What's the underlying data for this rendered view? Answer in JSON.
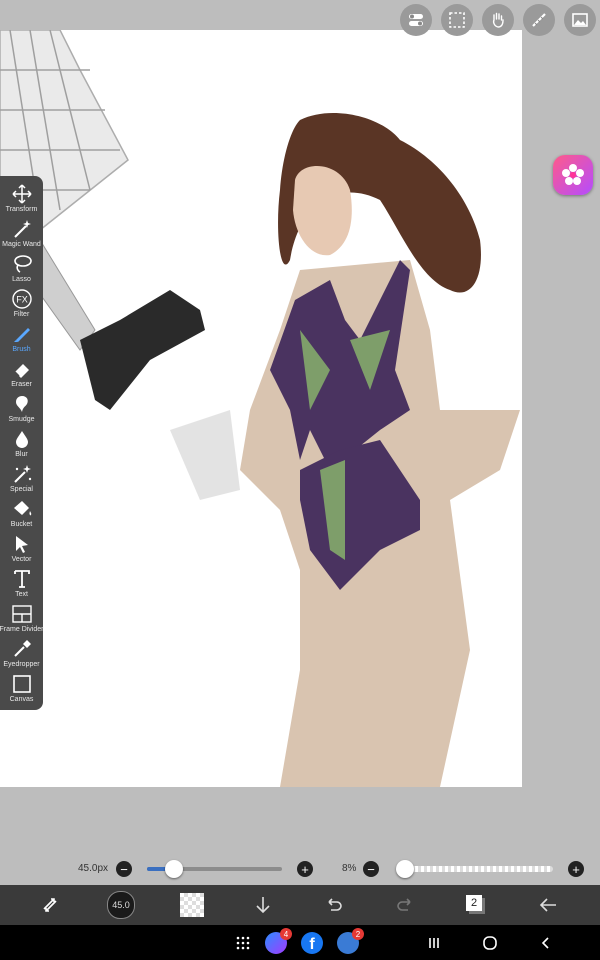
{
  "top_actions": [
    {
      "name": "toggle-panel-button",
      "icon": "toggle-switch-icon"
    },
    {
      "name": "selection-button",
      "icon": "dashed-rect-icon"
    },
    {
      "name": "hand-button",
      "icon": "hand-icon"
    },
    {
      "name": "ruler-button",
      "icon": "ruler-icon"
    },
    {
      "name": "gallery-button",
      "icon": "image-icon"
    }
  ],
  "tools": [
    {
      "label": "Transform",
      "icon": "move-arrows-icon"
    },
    {
      "label": "Magic Wand",
      "icon": "magic-wand-icon"
    },
    {
      "label": "Lasso",
      "icon": "lasso-icon"
    },
    {
      "label": "Filter",
      "icon": "fx-icon"
    },
    {
      "label": "Brush",
      "icon": "brush-icon",
      "active": true
    },
    {
      "label": "Eraser",
      "icon": "eraser-icon"
    },
    {
      "label": "Smudge",
      "icon": "smudge-icon"
    },
    {
      "label": "Blur",
      "icon": "drop-icon"
    },
    {
      "label": "Special",
      "icon": "sparkle-icon"
    },
    {
      "label": "Bucket",
      "icon": "bucket-icon"
    },
    {
      "label": "Vector",
      "icon": "cursor-arrow-icon"
    },
    {
      "label": "Text",
      "icon": "text-t-icon"
    },
    {
      "label": "Frame Divider",
      "icon": "frame-divider-icon"
    },
    {
      "label": "Eyedropper",
      "icon": "eyedropper-icon"
    },
    {
      "label": "Canvas",
      "icon": "canvas-square-icon"
    }
  ],
  "brush_size": {
    "text": "45.0px",
    "value": 45.0,
    "fraction": 0.2
  },
  "opacity": {
    "text": "8%",
    "value": 8,
    "fraction": 0.05
  },
  "bottom_bar": {
    "brush_preview_label": "45.0",
    "layer_count": "2"
  },
  "system_bar": {
    "messenger_badge": "4",
    "app3_badge": "2"
  },
  "colors": {
    "accent": "#5aa8ff",
    "slider_fill": "#3a6fc0",
    "toolbox_bg": "#4a4a4a",
    "bottom_bar_bg": "#3a3a3a"
  }
}
